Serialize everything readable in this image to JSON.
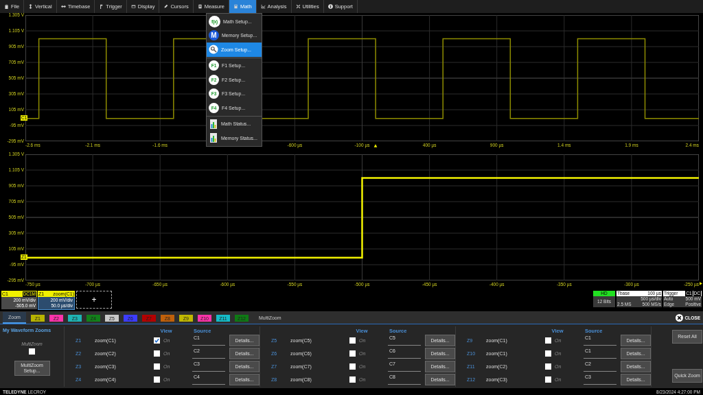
{
  "menu_bar": [
    {
      "label": "File",
      "selected": false
    },
    {
      "label": "Vertical",
      "selected": false
    },
    {
      "label": "Timebase",
      "selected": false
    },
    {
      "label": "Trigger",
      "selected": false
    },
    {
      "label": "Display",
      "selected": false
    },
    {
      "label": "Cursors",
      "selected": false
    },
    {
      "label": "Measure",
      "selected": false
    },
    {
      "label": "Math",
      "selected": true
    },
    {
      "label": "Analysis",
      "selected": false
    },
    {
      "label": "Utilities",
      "selected": false
    },
    {
      "label": "Support",
      "selected": false
    }
  ],
  "math_menu": [
    {
      "kind": "math",
      "badge": "f(x)",
      "label": "Math Setup...",
      "selected": false
    },
    {
      "kind": "memory",
      "badge": "M",
      "label": "Memory Setup...",
      "selected": false
    },
    {
      "kind": "zoom",
      "label": "Zoom Setup...",
      "selected": true
    },
    {
      "kind": "function",
      "badge": "F1",
      "label": "F1 Setup...",
      "selected": false
    },
    {
      "kind": "function",
      "badge": "F2",
      "label": "F2 Setup...",
      "selected": false
    },
    {
      "kind": "function",
      "badge": "F3",
      "label": "F3 Setup...",
      "selected": false
    },
    {
      "kind": "function",
      "badge": "F4",
      "label": "F4 Setup...",
      "selected": false
    },
    {
      "kind": "status",
      "label": "Math Status...",
      "selected": false
    },
    {
      "kind": "status",
      "label": "Memory Status...",
      "selected": false
    }
  ],
  "plots": [
    {
      "trace_label": "C1",
      "y_labels": [
        "1.305 V",
        "1.105 V",
        "905 mV",
        "705 mV",
        "505 mV",
        "305 mV",
        "105 mV",
        "-95 mV",
        "-295 mV"
      ],
      "x_labels": [
        "-2.6 ms",
        "-2.1 ms",
        "-1.6 ms",
        "-600 µs",
        "-100 µs",
        "400 µs",
        "900 µs",
        "1.4 ms",
        "1.9 ms",
        "2.4 ms"
      ]
    },
    {
      "trace_label": "Z1",
      "y_labels": [
        "1.305 V",
        "1.105 V",
        "905 mV",
        "705 mV",
        "505 mV",
        "305 mV",
        "105 mV",
        "-95 mV",
        "-295 mV"
      ],
      "x_labels": [
        "-750 µs",
        "-700 µs",
        "-650 µs",
        "-600 µs",
        "-550 µs",
        "-500 µs",
        "-450 µs",
        "-400 µs",
        "-350 µs",
        "-300 µs",
        "-250 µs"
      ]
    }
  ],
  "descriptors": {
    "channel": {
      "label": "C1",
      "coupling": "DC1M",
      "lines": [
        "200 mV/div",
        "-505.0 mV"
      ]
    },
    "zoom": {
      "label": "Z1",
      "name": "zoom(C1)",
      "lines": [
        "200 mV/div",
        "50.0 µs/div"
      ]
    },
    "add": "+"
  },
  "acquisition": {
    "hd": {
      "label": "HD",
      "bits": "12 Bits"
    },
    "timebase": {
      "label": "Tbase",
      "delay": "100 µs",
      "per_div": "500 µs/div",
      "samples": "2.5 MS",
      "rate": "500 MS/s"
    },
    "trigger": {
      "label": "Trigger",
      "source": "C1",
      "coupling": "DC",
      "mode": "Auto",
      "trigger_level": "500 mV",
      "type": "Edge",
      "slope": "Positive"
    }
  },
  "panel": {
    "tabs": [
      {
        "label": "Zoom",
        "selected": true
      },
      {
        "label": "Z1",
        "color": "#b8b400",
        "selected": false
      },
      {
        "label": "Z2",
        "color": "#ff33aa",
        "selected": false
      },
      {
        "label": "Z3",
        "color": "#1eb4b4",
        "selected": false
      },
      {
        "label": "Z4",
        "color": "#12801a",
        "selected": false
      },
      {
        "label": "Z5",
        "color": "#c8c8c8",
        "selected": false
      },
      {
        "label": "Z6",
        "color": "#3c3cff",
        "selected": false
      },
      {
        "label": "Z7",
        "color": "#b40000",
        "selected": false
      },
      {
        "label": "Z8",
        "color": "#c0600a",
        "selected": false
      },
      {
        "label": "Z9",
        "color": "#c0b800",
        "selected": false
      },
      {
        "label": "Z10",
        "color": "#ff33aa",
        "selected": false
      },
      {
        "label": "Z11",
        "color": "#14bcc8",
        "selected": false
      },
      {
        "label": "Z12",
        "color": "#0e7a14",
        "selected": false
      },
      {
        "label": "MultiZoom",
        "selected": false
      }
    ],
    "close": "CLOSE",
    "title": "My Waveform Zooms",
    "multizoom": {
      "label": "MultiZoom",
      "checked": false
    },
    "setup_button": "MultiZoom Setup...",
    "groups": [
      {
        "view_header": "View",
        "source_header": "Source",
        "rows": [
          {
            "id": "Z1",
            "name": "zoom(C1)",
            "checked": true,
            "on_label": "On",
            "source": "C1",
            "details": "Details..."
          },
          {
            "id": "Z2",
            "name": "zoom(C2)",
            "checked": false,
            "on_label": "On",
            "source": "C2",
            "details": "Details..."
          },
          {
            "id": "Z3",
            "name": "zoom(C3)",
            "checked": false,
            "on_label": "On",
            "source": "C3",
            "details": "Details..."
          },
          {
            "id": "Z4",
            "name": "zoom(C4)",
            "checked": false,
            "on_label": "On",
            "source": "C4",
            "details": "Details..."
          }
        ]
      },
      {
        "view_header": "View",
        "source_header": "Source",
        "rows": [
          {
            "id": "Z5",
            "name": "zoom(C5)",
            "checked": false,
            "on_label": "On",
            "source": "C5",
            "details": "Details..."
          },
          {
            "id": "Z6",
            "name": "zoom(C6)",
            "checked": false,
            "on_label": "On",
            "source": "C6",
            "details": "Details..."
          },
          {
            "id": "Z7",
            "name": "zoom(C7)",
            "checked": false,
            "on_label": "On",
            "source": "C7",
            "details": "Details..."
          },
          {
            "id": "Z8",
            "name": "zoom(C8)",
            "checked": false,
            "on_label": "On",
            "source": "C8",
            "details": "Details..."
          }
        ]
      },
      {
        "view_header": "View",
        "source_header": "Source",
        "rows": [
          {
            "id": "Z9",
            "name": "zoom(C1)",
            "checked": false,
            "on_label": "On",
            "source": "C1",
            "details": "Details..."
          },
          {
            "id": "Z10",
            "name": "zoom(C1)",
            "checked": false,
            "on_label": "On",
            "source": "C1",
            "details": "Details..."
          },
          {
            "id": "Z11",
            "name": "zoom(C2)",
            "checked": false,
            "on_label": "On",
            "source": "C2",
            "details": "Details..."
          },
          {
            "id": "Z12",
            "name": "zoom(C3)",
            "checked": false,
            "on_label": "On",
            "source": "C3",
            "details": "Details..."
          }
        ]
      }
    ],
    "reset_button": "Reset All",
    "quick_button": "Quick Zoom"
  },
  "footer": {
    "brand": "**TELEDYNE** LECROY",
    "datetime": "8/23/2024 4:27:00 PM"
  }
}
